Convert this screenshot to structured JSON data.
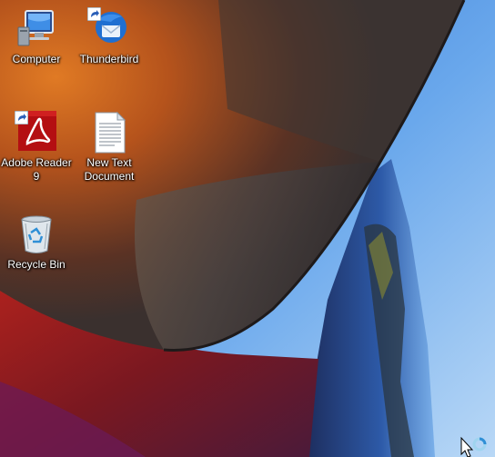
{
  "desktop": {
    "icons": [
      {
        "id": "computer",
        "label": "Computer",
        "icon": "computer-icon"
      },
      {
        "id": "thunderbird",
        "label": "Thunderbird",
        "icon": "thunderbird-icon",
        "shortcut": true
      },
      {
        "id": "adobe-reader",
        "label": "Adobe Reader\n9",
        "icon": "adobe-reader-icon",
        "shortcut": true
      },
      {
        "id": "new-text-document",
        "label": "New Text\nDocument",
        "icon": "text-document-icon"
      },
      {
        "id": "recycle-bin",
        "label": "Recycle Bin",
        "icon": "recycle-bin-icon"
      }
    ],
    "cursor": "busy-arrow-cursor"
  },
  "colors": {
    "sky": "#5a9ae0",
    "building_dark": "#3a3230",
    "building_orange": "#b5531c",
    "building_red": "#8e1c1a",
    "label_text": "#ffffff"
  }
}
